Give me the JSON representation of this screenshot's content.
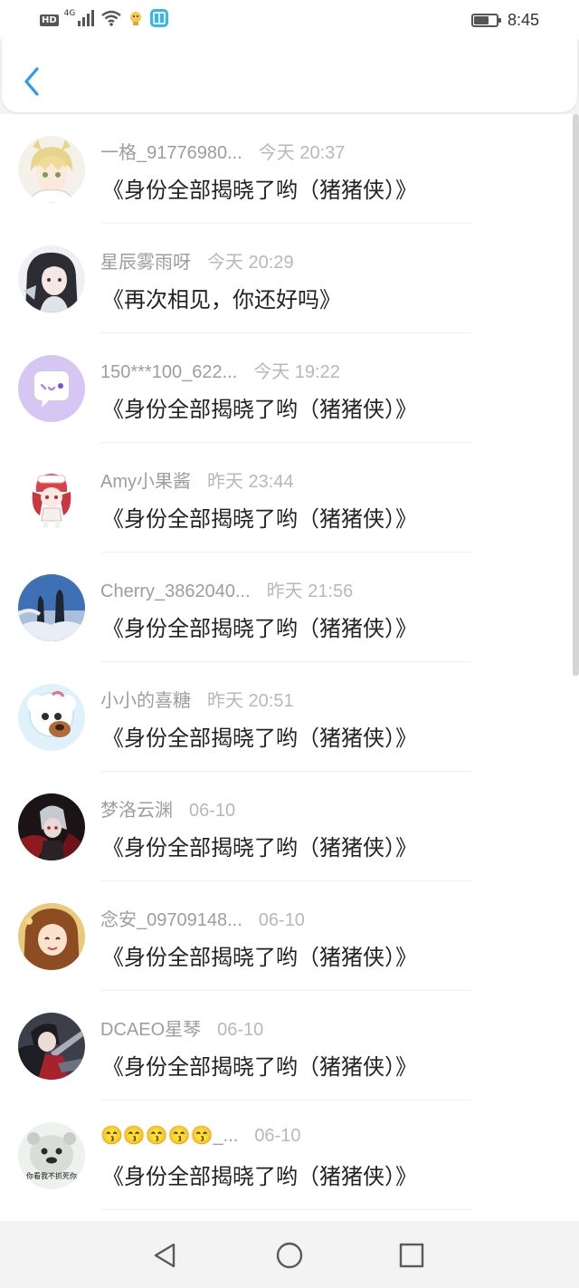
{
  "status_bar": {
    "network_badge": "HD",
    "signal_type": "4G",
    "time": "8:45",
    "icons": [
      "hd-badge-icon",
      "signal-icon",
      "wifi-icon",
      "notification-app-icon",
      "reader-app-icon",
      "battery-icon"
    ]
  },
  "header": {
    "back_icon": "chevron-left-icon",
    "accent_color": "#2b9af3"
  },
  "list": {
    "items": [
      {
        "name": "一格_91776980...",
        "time": "今天 20:37",
        "message": "《身份全部揭晓了哟（猪猪侠）》",
        "avatar": "anime-boy-blonde-avatar"
      },
      {
        "name": "星辰雾雨呀",
        "time": "今天 20:29",
        "message": "《再次相见，你还好吗》",
        "avatar": "anime-girl-dark-hair-avatar"
      },
      {
        "name": "150***100_622...",
        "time": "今天 19:22",
        "message": "《身份全部揭晓了哟（猪猪侠）》",
        "avatar": "default-chat-bubble-avatar"
      },
      {
        "name": "Amy小果酱",
        "time": "昨天 23:44",
        "message": "《身份全部揭晓了哟（猪猪侠）》",
        "avatar": "chibi-girl-red-avatar"
      },
      {
        "name": "Cherry_3862040...",
        "time": "昨天 21:56",
        "message": "《身份全部揭晓了哟（猪猪侠）》",
        "avatar": "winter-scene-avatar"
      },
      {
        "name": "小小的喜糖",
        "time": "昨天 20:51",
        "message": "《身份全部揭晓了哟（猪猪侠）》",
        "avatar": "cartoon-sheep-avatar"
      },
      {
        "name": "梦洛云渊",
        "time": "06-10",
        "message": "《身份全部揭晓了哟（猪猪侠）》",
        "avatar": "dark-red-anime-avatar"
      },
      {
        "name": "念安_09709148...",
        "time": "06-10",
        "message": "《身份全部揭晓了哟（猪猪侠）》",
        "avatar": "anime-girl-brown-hair-avatar"
      },
      {
        "name": "DCAEO星琴",
        "time": "06-10",
        "message": "《身份全部揭晓了哟（猪猪侠）》",
        "avatar": "anime-warrior-avatar"
      },
      {
        "name": "😙😙😙😙😙_...",
        "time": "06-10",
        "message": "《身份全部揭晓了哟（猪猪侠）》",
        "avatar": "meme-bear-avatar",
        "avatar_text": "你看我不抓死你"
      }
    ]
  },
  "nav_bar": {
    "icons": [
      "back-triangle-icon",
      "home-circle-icon",
      "recents-square-icon"
    ]
  },
  "colors": {
    "name_gray": "#9d9d9d",
    "time_gray": "#b8b8b8",
    "message": "#222222",
    "accent": "#2b9af3"
  }
}
